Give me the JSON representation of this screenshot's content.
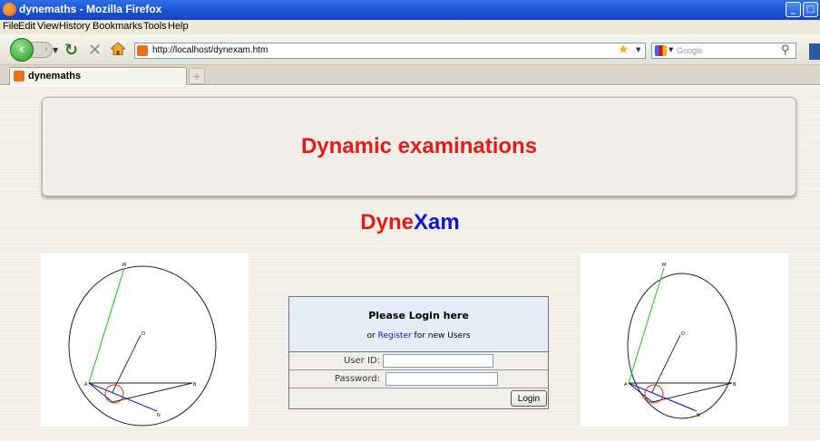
{
  "window": {
    "title": "dynemaths - Mozilla Firefox",
    "min": "_",
    "max": "□",
    "close": "×"
  },
  "menu": [
    "File",
    "Edit",
    "View",
    "History",
    "Bookmarks",
    "Tools",
    "Help"
  ],
  "nav": {
    "url": "http://localhost/dynexam.htm",
    "search_placeholder": "Google"
  },
  "tab": {
    "label": "dynemaths",
    "new_tab": "+"
  },
  "page": {
    "header_title": "Dynamic examinations",
    "brand_part1": "Dyne",
    "brand_part2": "Xam",
    "login": {
      "heading": "Please Login here",
      "register_prefix": "or ",
      "register_link": "Register",
      "register_suffix": " for new Users",
      "userid_label": "User ID:",
      "password_label": "Password:",
      "login_button": "Login"
    },
    "diagram_labels": [
      "M",
      "O",
      "A",
      "B",
      "N"
    ]
  },
  "colors": {
    "title": "#e41b17",
    "brand_blue": "#1515c9"
  }
}
